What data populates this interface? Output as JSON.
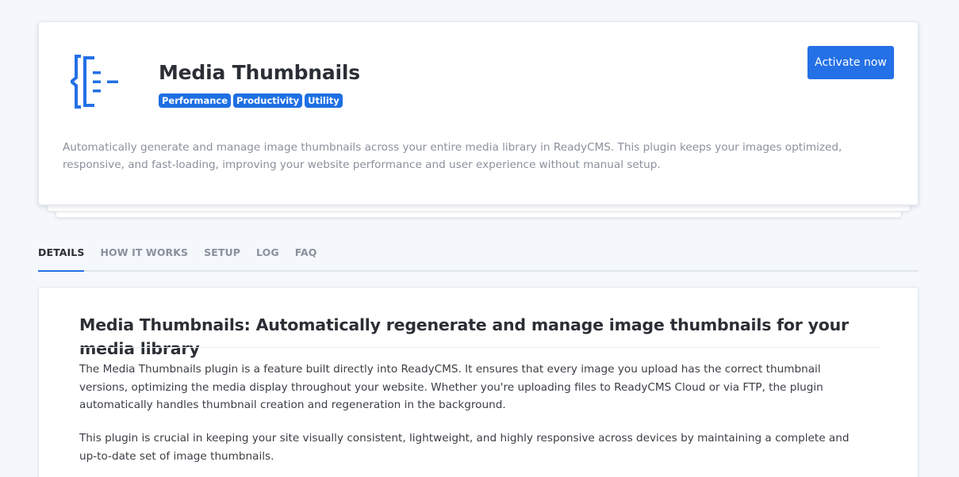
{
  "plugin": {
    "title": "Media Thumbnails",
    "logo_icon": "media-thumbnails-logo-icon",
    "brand_color": "#2470e6",
    "tags": [
      "Performance",
      "Productivity",
      "Utility"
    ],
    "activate_label": "Activate now",
    "description": "Automatically generate and manage image thumbnails across your entire media library in ReadyCMS. This plugin keeps your images optimized, responsive, and fast-loading, improving your website performance and user experience without manual setup."
  },
  "tabs": [
    {
      "label": "DETAILS",
      "active": true
    },
    {
      "label": "HOW IT WORKS",
      "active": false
    },
    {
      "label": "SETUP",
      "active": false
    },
    {
      "label": "LOG",
      "active": false
    },
    {
      "label": "FAQ",
      "active": false
    }
  ],
  "details": {
    "heading": "Media Thumbnails: Automatically regenerate and manage image thumbnails for your media library",
    "paragraphs": [
      "The Media Thumbnails plugin is a feature built directly into ReadyCMS. It ensures that every image you upload has the correct thumbnail versions, optimizing the media display throughout your website. Whether you're uploading files to ReadyCMS Cloud or via FTP, the plugin automatically handles thumbnail creation and regeneration in the background.",
      "This plugin is crucial in keeping your site visually consistent, lightweight, and highly responsive across devices by maintaining a complete and up-to-date set of image thumbnails."
    ]
  }
}
